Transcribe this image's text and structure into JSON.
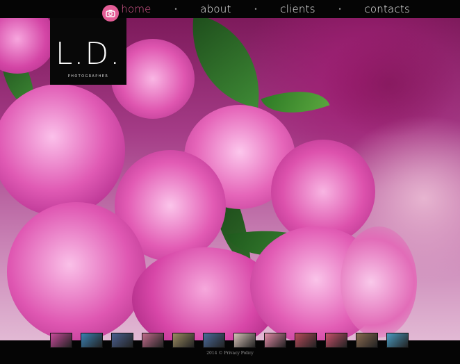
{
  "nav": {
    "items": [
      {
        "label": "home",
        "active": true
      },
      {
        "label": "about",
        "active": false
      },
      {
        "label": "clients",
        "active": false
      },
      {
        "label": "contacts",
        "active": false
      }
    ],
    "separator": "•",
    "accent_color": "#e35d96"
  },
  "logo": {
    "initials": "L.D.",
    "subtitle": "PHOTOGRAPHER",
    "badge_icon": "camera-icon"
  },
  "hero": {
    "description_colors": {
      "primary": "#e84aa8",
      "leaf": "#2d6a24"
    }
  },
  "thumbnails": [
    {
      "name": "thumb-roses",
      "color": "#c84a9a"
    },
    {
      "name": "thumb-coast",
      "color": "#3a7fb0"
    },
    {
      "name": "thumb-sunset",
      "color": "#4a5f8f"
    },
    {
      "name": "thumb-legs",
      "color": "#c06a8a"
    },
    {
      "name": "thumb-note",
      "color": "#9a8a60"
    },
    {
      "name": "thumb-couple",
      "color": "#4a6a9a"
    },
    {
      "name": "thumb-cake",
      "color": "#d6c2b8"
    },
    {
      "name": "thumb-cupcakes",
      "color": "#e38aa6"
    },
    {
      "name": "thumb-macarons",
      "color": "#b84a5a"
    },
    {
      "name": "thumb-dessert",
      "color": "#c8506a"
    },
    {
      "name": "thumb-hands",
      "color": "#8a6a50"
    },
    {
      "name": "thumb-ocean",
      "color": "#4a9ac0"
    }
  ],
  "footer": {
    "year": "2014",
    "copyright_symbol": "©",
    "link": "Privacy Policy"
  }
}
